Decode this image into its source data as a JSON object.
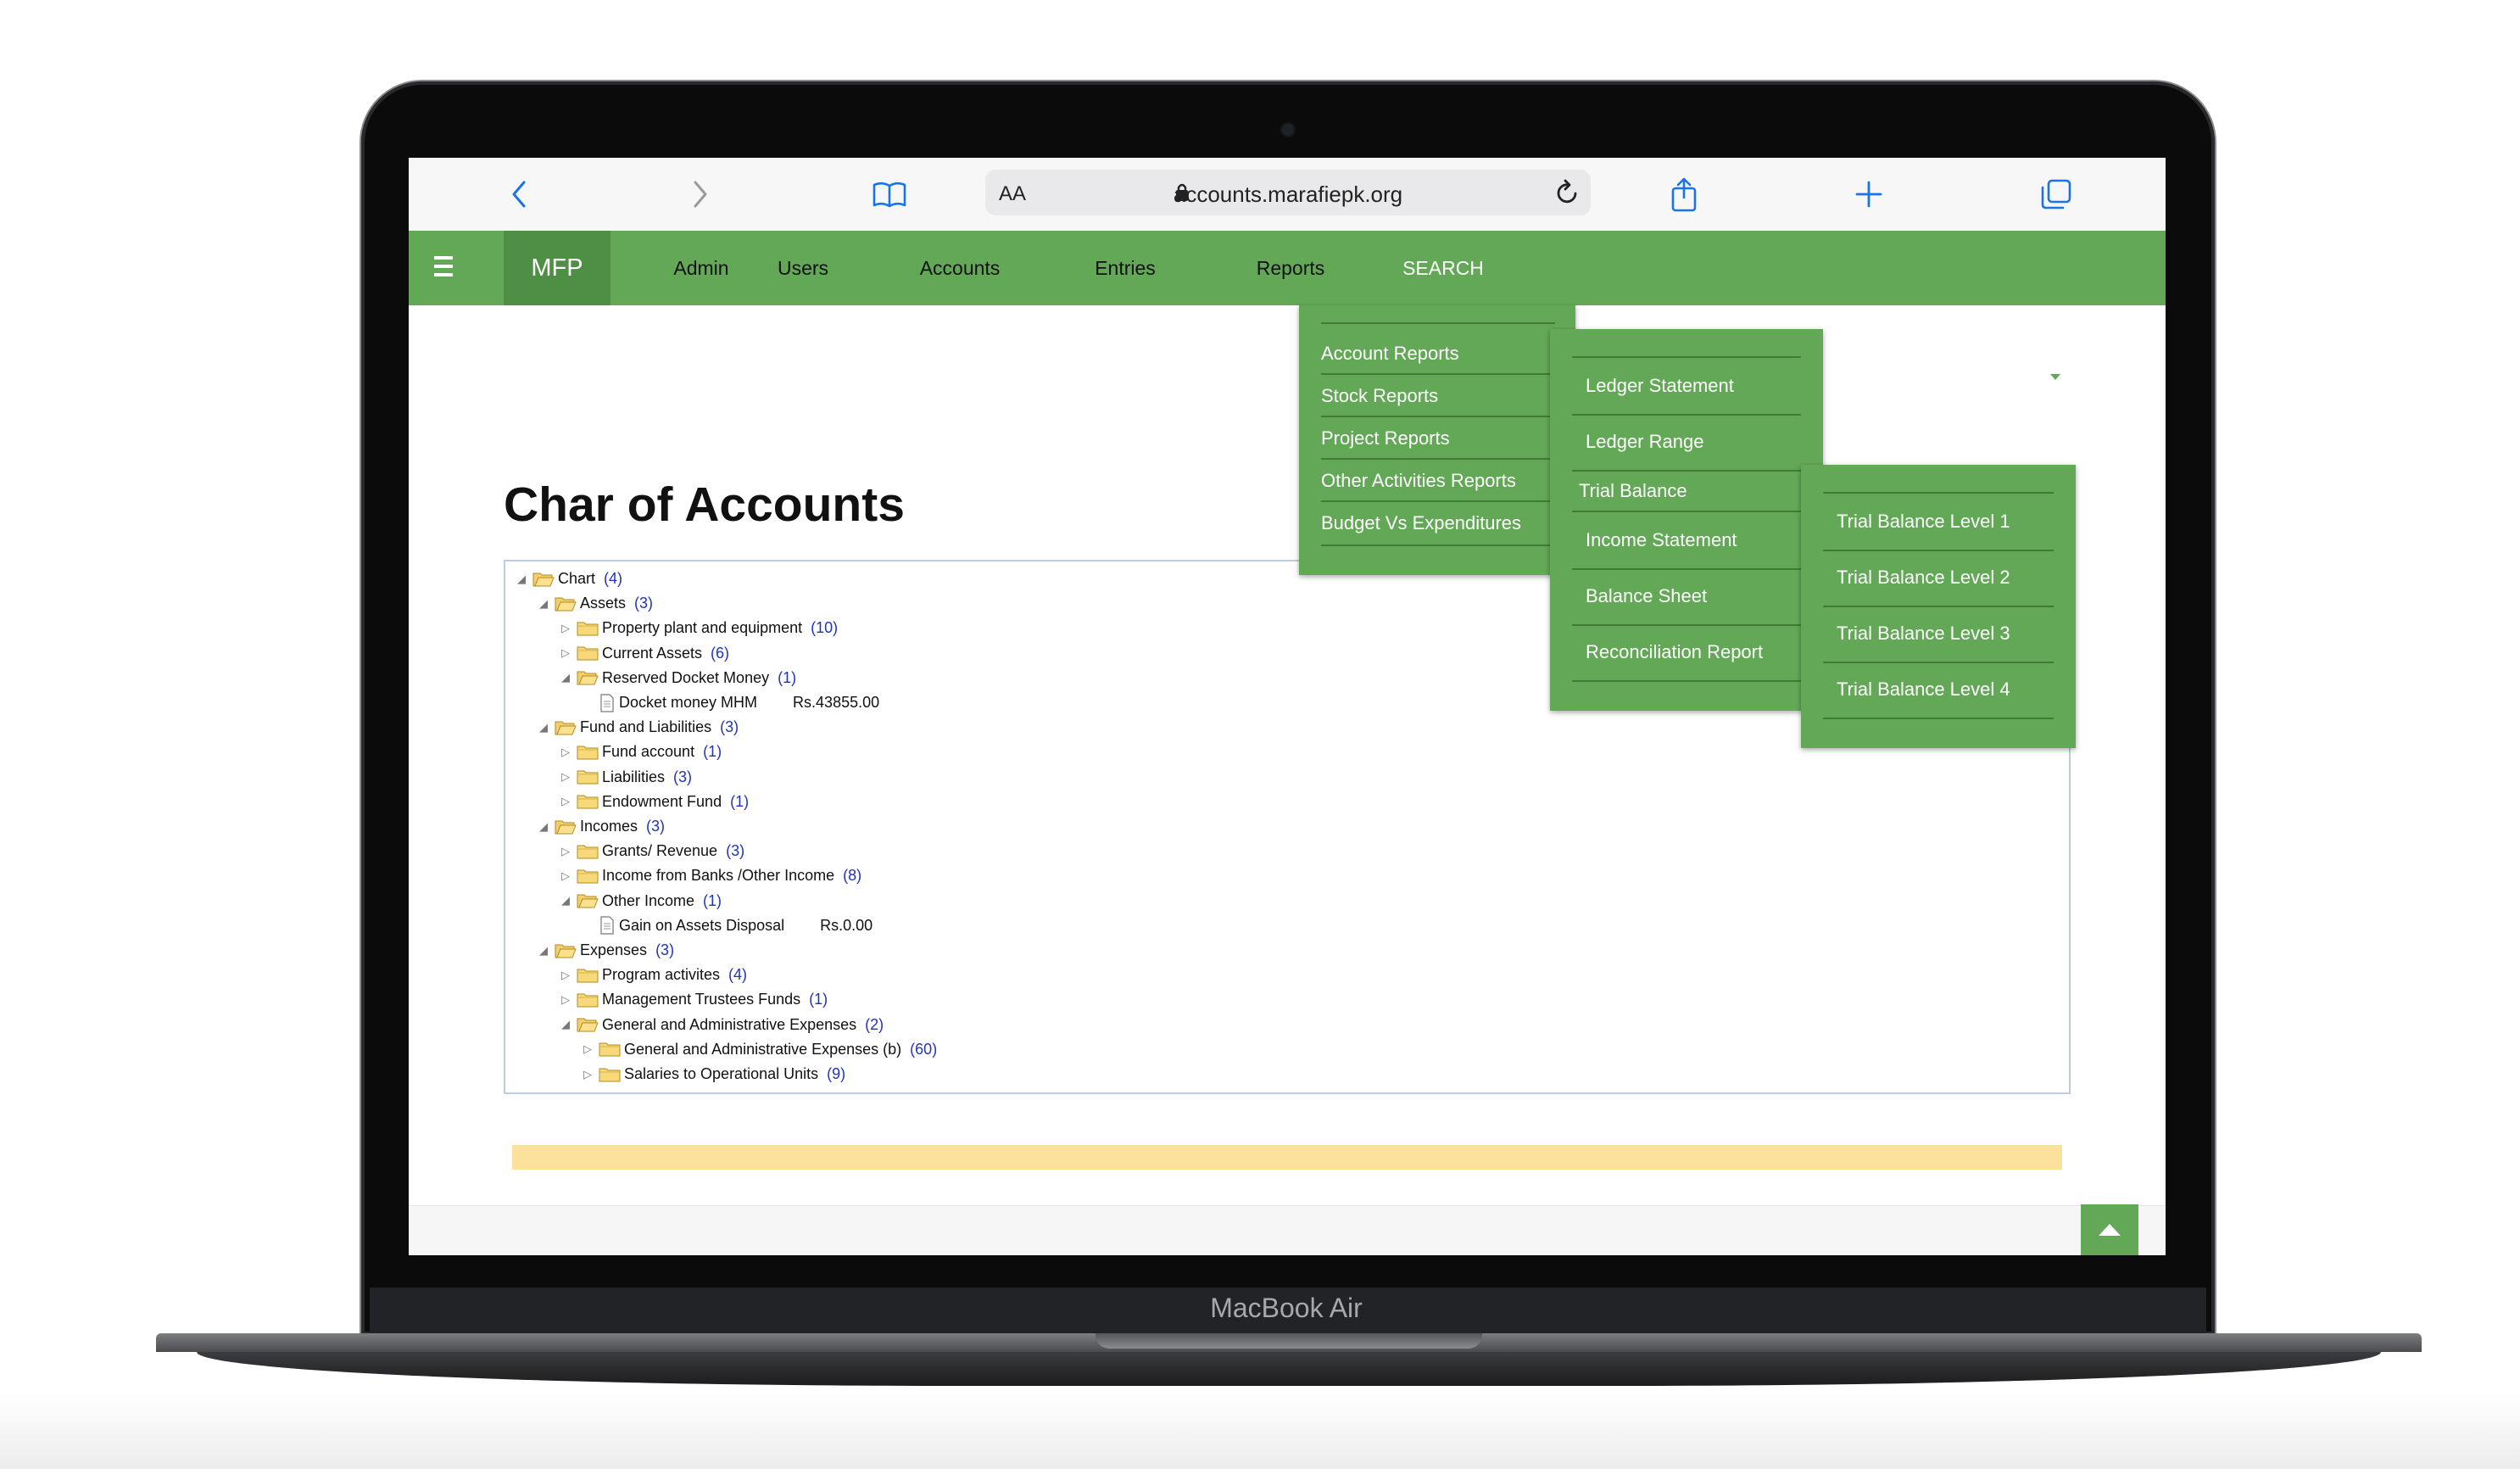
{
  "device": {
    "brand_label": "MacBook Air"
  },
  "browser": {
    "aa_label": "AA",
    "url": "accounts.marafiepk.org"
  },
  "nav": {
    "brand": "MFP",
    "items": [
      "Admin",
      "Users",
      "Accounts",
      "Entries",
      "Reports",
      "SEARCH"
    ]
  },
  "menus": {
    "reports": [
      "Account Reports",
      "Stock Reports",
      "Project Reports",
      "Other Activities Reports",
      "Budget Vs Expenditures"
    ],
    "account_reports": [
      "Ledger Statement",
      "Ledger Range",
      "Trial Balance",
      "Income Statement",
      "Balance Sheet",
      "Reconciliation Report"
    ],
    "trial_balance": [
      "Trial Balance Level 1",
      "Trial Balance Level 2",
      "Trial Balance Level 3",
      "Trial Balance Level 4"
    ]
  },
  "page": {
    "title": "Char of Accounts"
  },
  "tree": [
    {
      "label": "Chart",
      "count": "(4)",
      "amount": ""
    },
    {
      "label": "Assets",
      "count": "(3)",
      "amount": ""
    },
    {
      "label": "Property plant and equipment",
      "count": "(10)",
      "amount": ""
    },
    {
      "label": "Current Assets",
      "count": "(6)",
      "amount": ""
    },
    {
      "label": "Reserved Docket Money",
      "count": "(1)",
      "amount": ""
    },
    {
      "label": "Docket money MHM",
      "count": "",
      "amount": "Rs.43855.00"
    },
    {
      "label": "Fund and Liabilities",
      "count": "(3)",
      "amount": ""
    },
    {
      "label": "Fund account",
      "count": "(1)",
      "amount": ""
    },
    {
      "label": "Liabilities",
      "count": "(3)",
      "amount": ""
    },
    {
      "label": "Endowment Fund",
      "count": "(1)",
      "amount": ""
    },
    {
      "label": "Incomes",
      "count": "(3)",
      "amount": ""
    },
    {
      "label": "Grants/ Revenue",
      "count": "(3)",
      "amount": ""
    },
    {
      "label": "Income from Banks /Other Income",
      "count": "(8)",
      "amount": ""
    },
    {
      "label": "Other Income",
      "count": "(1)",
      "amount": ""
    },
    {
      "label": "Gain on Assets Disposal",
      "count": "",
      "amount": "Rs.0.00"
    },
    {
      "label": "Expenses",
      "count": "(3)",
      "amount": ""
    },
    {
      "label": "Program activites",
      "count": "(4)",
      "amount": ""
    },
    {
      "label": "Management Trustees Funds",
      "count": "(1)",
      "amount": ""
    },
    {
      "label": "General and Administrative Expenses",
      "count": "(2)",
      "amount": ""
    },
    {
      "label": "General and Administrative Expenses (b)",
      "count": "(60)",
      "amount": ""
    },
    {
      "label": "Salaries to Operational Units",
      "count": "(9)",
      "amount": ""
    }
  ],
  "colors": {
    "nav_green": "#63a857",
    "highlight": "#fbe19b",
    "count_blue": "#2233bb"
  }
}
